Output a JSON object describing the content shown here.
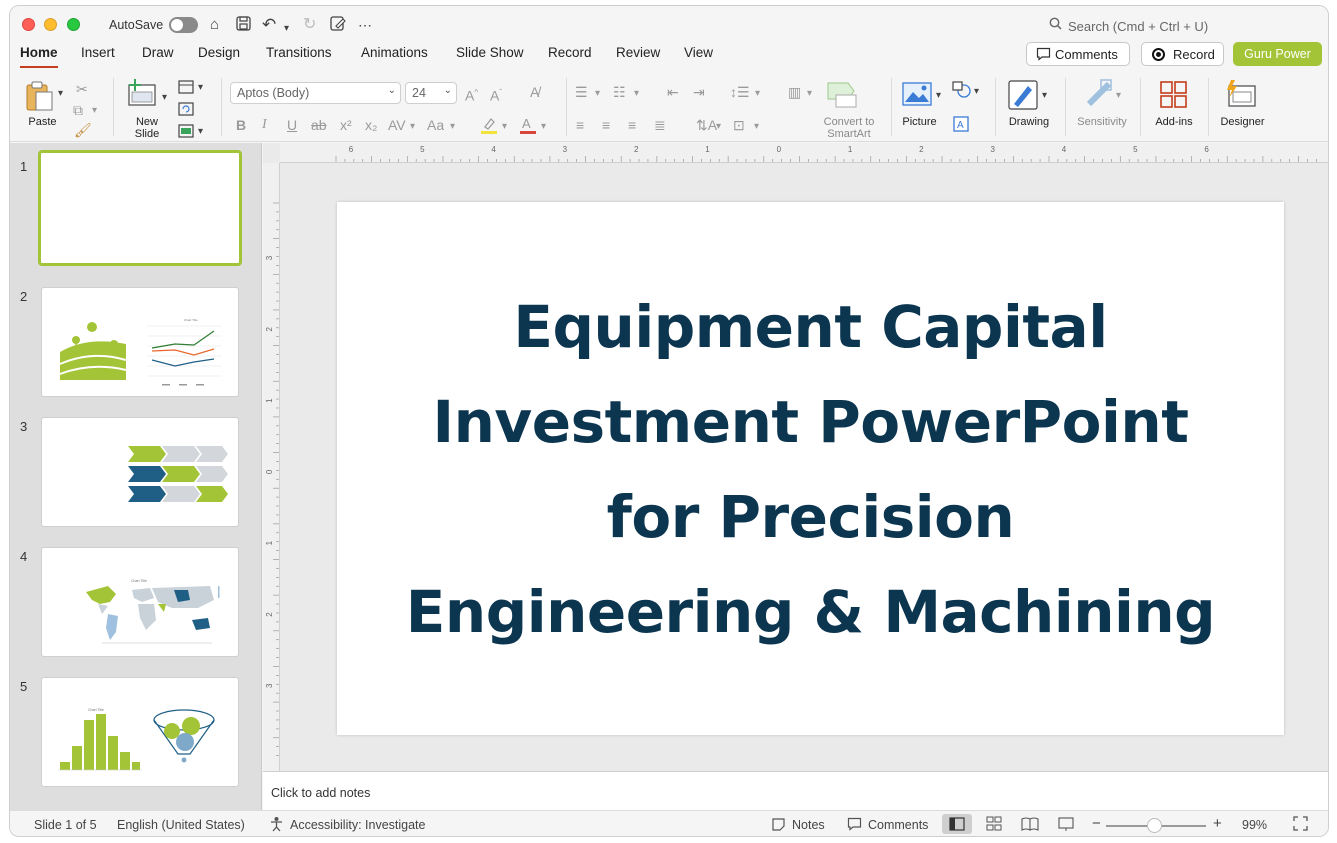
{
  "titlebar": {
    "autosave_label": "AutoSave",
    "search_placeholder": "Search (Cmd + Ctrl + U)"
  },
  "tabs": [
    "Home",
    "Insert",
    "Draw",
    "Design",
    "Transitions",
    "Animations",
    "Slide Show",
    "Record",
    "Review",
    "View"
  ],
  "header_buttons": {
    "comments": "Comments",
    "record": "Record",
    "guru": "Guru Power"
  },
  "ribbon": {
    "paste": "Paste",
    "new_slide": "New Slide",
    "font_name": "Aptos (Body)",
    "font_size": "24",
    "convert_smartart": "Convert to SmartArt",
    "picture": "Picture",
    "drawing": "Drawing",
    "sensitivity": "Sensitivity",
    "addins": "Add-ins",
    "designer": "Designer"
  },
  "slides": [
    {
      "num": "1"
    },
    {
      "num": "2",
      "chart_title": "Chart Title"
    },
    {
      "num": "3"
    },
    {
      "num": "4",
      "chart_title": "Chart Title"
    },
    {
      "num": "5",
      "chart_title": "Chart Title"
    }
  ],
  "ruler": {
    "h_labels": [
      "6",
      "5",
      "4",
      "3",
      "2",
      "1",
      "0",
      "1",
      "2",
      "3",
      "4",
      "5",
      "6"
    ],
    "v_labels": [
      "3",
      "2",
      "1",
      "0",
      "1",
      "2",
      "3"
    ]
  },
  "slide_main": {
    "title_line1": "Equipment Capital",
    "title_line2": "Investment PowerPoint",
    "title_line3": "for Precision",
    "title_line4": "Engineering & Machining"
  },
  "notes": {
    "placeholder": "Click to add notes"
  },
  "status": {
    "slide_count": "Slide 1 of 5",
    "language": "English (United States)",
    "accessibility": "Accessibility: Investigate",
    "notes_btn": "Notes",
    "comments_btn": "Comments",
    "zoom": "99%"
  },
  "colors": {
    "accent_green": "#a4c438",
    "title_navy": "#0c3550",
    "active_tab_underline": "#c43e1c"
  }
}
